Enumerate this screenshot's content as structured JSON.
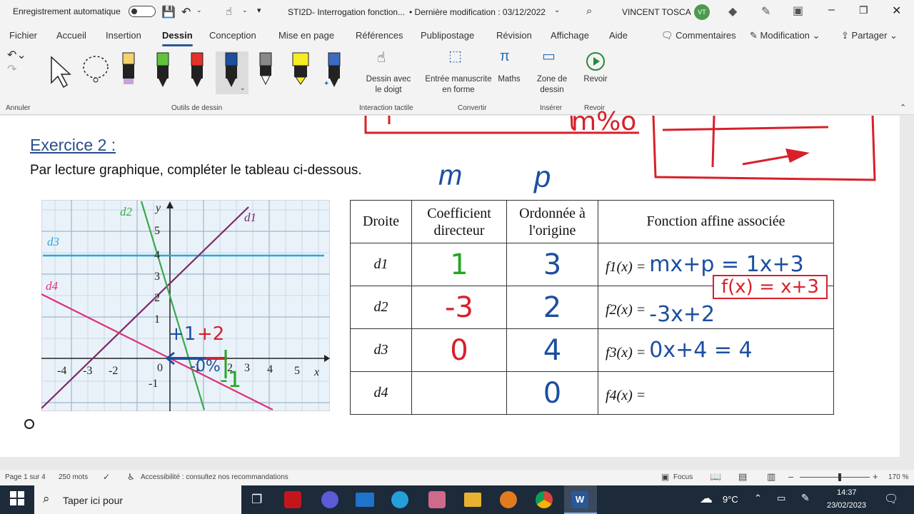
{
  "titlebar": {
    "autosave_label": "Enregistrement automatique",
    "doc_title": "STI2D- Interrogation fonction...",
    "modified": "• Dernière modification : 03/12/2022",
    "user_name": "VINCENT TOSCA",
    "user_initials": "VT"
  },
  "menu": [
    "Fichier",
    "Accueil",
    "Insertion",
    "Dessin",
    "Conception",
    "Mise en page",
    "Références",
    "Publipostage",
    "Révision",
    "Affichage",
    "Aide"
  ],
  "menu_right": {
    "comments": "Commentaires",
    "mode": "Modification",
    "share": "Partager"
  },
  "ribbon": {
    "groups": {
      "undo": "Annuler",
      "tools": "Outils de dessin",
      "touch": "Interaction tactile",
      "convert": "Convertir",
      "insert": "Insérer",
      "replay": "Revoir"
    },
    "buttons": {
      "draw_finger": "Dessin avec le doigt",
      "ink_shape": "Entrée manuscrite en forme",
      "math": "Maths",
      "canvas": "Zone de dessin",
      "replay": "Revoir"
    }
  },
  "document": {
    "exercise_title": "Exercice 2 :",
    "instruction": "Par lecture graphique, compléter le tableau ci-dessous.",
    "table": {
      "headers": [
        "Droite",
        "Coefficient directeur",
        "Ordonnée à l'origine",
        "Fonction affine associée"
      ],
      "rows": [
        {
          "line": "d1",
          "coef": "1",
          "origin": "3",
          "func_label": "f1(x) =",
          "func_hand": "mx+p = 1x+3",
          "func_hand2": "f(x) = x+3"
        },
        {
          "line": "d2",
          "coef": "-3",
          "origin": "2",
          "func_label": "f2(x) =",
          "func_hand": "-3x+2",
          "func_hand2": ""
        },
        {
          "line": "d3",
          "coef": "0",
          "origin": "4",
          "func_label": "f3(x) =",
          "func_hand": "0x+4 = 4",
          "func_hand2": ""
        },
        {
          "line": "d4",
          "coef": "",
          "origin": "0",
          "func_label": "f4(x) =",
          "func_hand": "",
          "func_hand2": ""
        }
      ]
    },
    "annotations": {
      "m": "m",
      "p": "p"
    },
    "graph": {
      "x_label": "x",
      "y_label": "y",
      "x_ticks": [
        "-4",
        "-3",
        "-2",
        "0",
        "1",
        "2",
        "3",
        "4",
        "5"
      ],
      "y_ticks": [
        "5",
        "4",
        "3",
        "2",
        "1",
        "-1"
      ],
      "line_labels": [
        "d1",
        "d2",
        "d3",
        "d4"
      ]
    }
  },
  "statusbar": {
    "page": "Page 1 sur 4",
    "words": "250 mots",
    "accessibility": "Accessibilité : consultez nos recommandations",
    "focus": "Focus",
    "zoom": "170 %"
  },
  "taskbar": {
    "search": "Taper ici pour",
    "weather": "9°C",
    "time": "14:37",
    "date": "23/02/2023"
  }
}
